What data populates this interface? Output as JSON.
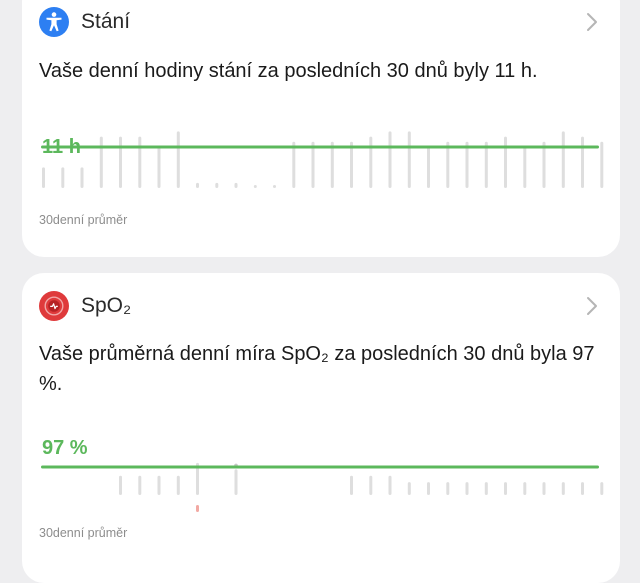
{
  "cards": {
    "standing": {
      "title": "Stání",
      "icon": "accessibility-person-icon",
      "icon_color": "#2d7ff2",
      "summary": "Vaše denní hodiny stání za posledních 30 dnů byly 11 h.",
      "avg_label": "11 h",
      "caption": "30denní průměr"
    },
    "spo2": {
      "title": "SpO₂",
      "icon": "blood-oxygen-icon",
      "icon_color": "#df3a3b",
      "summary": "Vaše průměrná denní míra SpO₂ za posledních 30 dnů byla 97 %.",
      "avg_label": "97 %",
      "caption": "30denní průměr"
    }
  },
  "colors": {
    "accent_green": "#5cb85c",
    "bar_gray": "#dedede",
    "card_bg": "#ffffff",
    "page_bg": "#eeeef0"
  },
  "chart_data": [
    {
      "type": "bar",
      "series": [
        {
          "values": [
            4,
            4,
            4,
            10,
            10,
            10,
            8,
            11,
            1,
            1,
            1,
            0.5,
            0.5,
            9,
            9,
            9,
            9,
            10,
            11,
            11,
            8,
            9,
            9,
            9,
            10,
            8,
            9,
            11,
            10,
            9
          ]
        }
      ],
      "average": 11,
      "average_label": "11 h",
      "ylim": [
        0,
        14
      ]
    },
    {
      "type": "bar",
      "series": [
        {
          "values": [
            null,
            null,
            null,
            null,
            96,
            96,
            96,
            96,
            98,
            null,
            97,
            null,
            null,
            null,
            null,
            null,
            96,
            96,
            96,
            95,
            95,
            95,
            95,
            95,
            95,
            95,
            95,
            95,
            95,
            95
          ]
        }
      ],
      "point_marker_days": [
        10
      ],
      "low_marker_days": [
        8
      ],
      "average": 97,
      "average_label": "97 %",
      "ylim": [
        93,
        100
      ]
    }
  ]
}
